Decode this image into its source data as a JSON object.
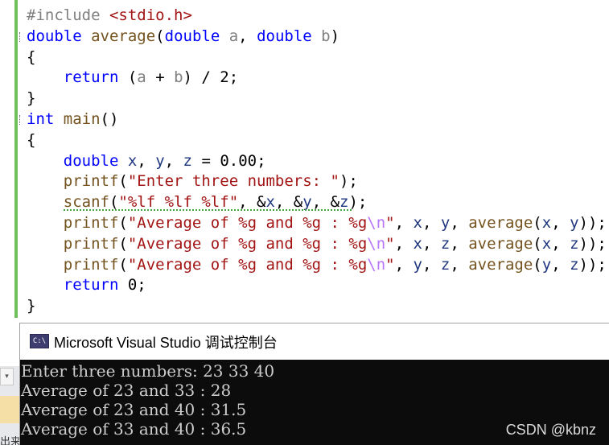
{
  "editor": {
    "lines": [
      [
        {
          "t": "#include ",
          "c": "inc"
        },
        {
          "t": "<stdio.h>",
          "c": "incfile"
        }
      ],
      [
        {
          "t": "double",
          "c": "kw"
        },
        {
          "t": " "
        },
        {
          "t": "average",
          "c": "fn"
        },
        {
          "t": "("
        },
        {
          "t": "double",
          "c": "kw"
        },
        {
          "t": " "
        },
        {
          "t": "a",
          "c": "param"
        },
        {
          "t": ", "
        },
        {
          "t": "double",
          "c": "kw"
        },
        {
          "t": " "
        },
        {
          "t": "b",
          "c": "param"
        },
        {
          "t": ")"
        }
      ],
      [
        {
          "t": "{"
        }
      ],
      [
        {
          "t": "    "
        },
        {
          "t": "return",
          "c": "kw"
        },
        {
          "t": " ("
        },
        {
          "t": "a",
          "c": "param"
        },
        {
          "t": " + "
        },
        {
          "t": "b",
          "c": "param"
        },
        {
          "t": ") / 2;"
        }
      ],
      [
        {
          "t": "}"
        }
      ],
      [
        {
          "t": "int",
          "c": "kw"
        },
        {
          "t": " "
        },
        {
          "t": "main",
          "c": "fn"
        },
        {
          "t": "()"
        }
      ],
      [
        {
          "t": "{"
        }
      ],
      [
        {
          "t": "    "
        },
        {
          "t": "double",
          "c": "kw"
        },
        {
          "t": " "
        },
        {
          "t": "x",
          "c": "var"
        },
        {
          "t": ", "
        },
        {
          "t": "y",
          "c": "var"
        },
        {
          "t": ", "
        },
        {
          "t": "z",
          "c": "var"
        },
        {
          "t": " = 0.00;"
        }
      ],
      [
        {
          "t": "    "
        },
        {
          "t": "printf",
          "c": "fn"
        },
        {
          "t": "("
        },
        {
          "t": "\"Enter three numbers: \"",
          "c": "str"
        },
        {
          "t": ");"
        }
      ],
      [
        {
          "t": "    "
        },
        {
          "t": "scanf",
          "c": "fn"
        },
        {
          "t": "("
        },
        {
          "t": "\"%lf %lf %lf\"",
          "c": "str"
        },
        {
          "t": ", &"
        },
        {
          "t": "x",
          "c": "var"
        },
        {
          "t": ", &"
        },
        {
          "t": "y",
          "c": "var"
        },
        {
          "t": ", &"
        },
        {
          "t": "z",
          "c": "var"
        },
        {
          "t": ");"
        }
      ],
      [
        {
          "t": "    "
        },
        {
          "t": "printf",
          "c": "fn"
        },
        {
          "t": "("
        },
        {
          "t": "\"Average of %g and %g : %g",
          "c": "str"
        },
        {
          "t": "\\n",
          "c": "esc"
        },
        {
          "t": "\"",
          "c": "str"
        },
        {
          "t": ", "
        },
        {
          "t": "x",
          "c": "var"
        },
        {
          "t": ", "
        },
        {
          "t": "y",
          "c": "var"
        },
        {
          "t": ", "
        },
        {
          "t": "average",
          "c": "fn"
        },
        {
          "t": "("
        },
        {
          "t": "x",
          "c": "var"
        },
        {
          "t": ", "
        },
        {
          "t": "y",
          "c": "var"
        },
        {
          "t": "));"
        }
      ],
      [
        {
          "t": "    "
        },
        {
          "t": "printf",
          "c": "fn"
        },
        {
          "t": "("
        },
        {
          "t": "\"Average of %g and %g : %g",
          "c": "str"
        },
        {
          "t": "\\n",
          "c": "esc"
        },
        {
          "t": "\"",
          "c": "str"
        },
        {
          "t": ", "
        },
        {
          "t": "x",
          "c": "var"
        },
        {
          "t": ", "
        },
        {
          "t": "z",
          "c": "var"
        },
        {
          "t": ", "
        },
        {
          "t": "average",
          "c": "fn"
        },
        {
          "t": "("
        },
        {
          "t": "x",
          "c": "var"
        },
        {
          "t": ", "
        },
        {
          "t": "z",
          "c": "var"
        },
        {
          "t": "));"
        }
      ],
      [
        {
          "t": "    "
        },
        {
          "t": "printf",
          "c": "fn"
        },
        {
          "t": "("
        },
        {
          "t": "\"Average of %g and %g : %g",
          "c": "str"
        },
        {
          "t": "\\n",
          "c": "esc"
        },
        {
          "t": "\"",
          "c": "str"
        },
        {
          "t": ", "
        },
        {
          "t": "y",
          "c": "var"
        },
        {
          "t": ", "
        },
        {
          "t": "z",
          "c": "var"
        },
        {
          "t": ", "
        },
        {
          "t": "average",
          "c": "fn"
        },
        {
          "t": "("
        },
        {
          "t": "y",
          "c": "var"
        },
        {
          "t": ", "
        },
        {
          "t": "z",
          "c": "var"
        },
        {
          "t": "));"
        }
      ],
      [
        {
          "t": "    "
        },
        {
          "t": "return",
          "c": "kw"
        },
        {
          "t": " 0;"
        }
      ],
      [
        {
          "t": "}"
        }
      ]
    ]
  },
  "console": {
    "title": "Microsoft Visual Studio 调试控制台",
    "icon_label": "C:\\",
    "lines": [
      "Enter three numbers: 23 33 40",
      "Average of 23 and 33 : 28",
      "Average of 23 and 40 : 31.5",
      "Average of 33 and 40 : 36.5"
    ]
  },
  "left_panel": {
    "scroll_glyph": "▾",
    "text": "出来"
  },
  "watermark": "CSDN @kbnz"
}
